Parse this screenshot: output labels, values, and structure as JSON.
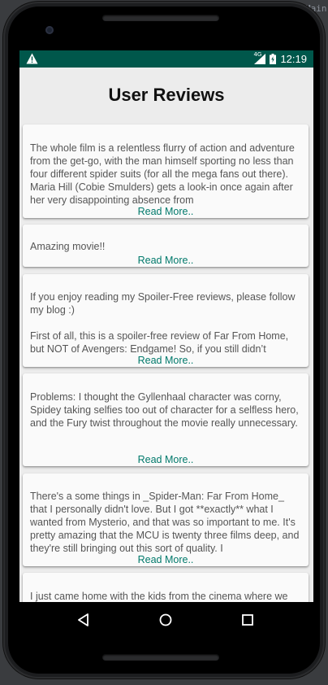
{
  "ide": {
    "right_fragment": "Main"
  },
  "status_bar": {
    "network_label": "4G",
    "time": "12:19"
  },
  "header": {
    "title": "User Reviews"
  },
  "reviews": [
    {
      "text": "The whole film is a relentless flurry of action and adventure from the get-go, with the man himself sporting no less than four different spider suits (for all the mega fans out there). Maria Hill (Cobie Smulders) gets a look-in once again after her very disappointing absence from",
      "link": "Read More.."
    },
    {
      "text": "Amazing movie!!",
      "link": "Read More.."
    },
    {
      "text": "If you enjoy reading my Spoiler-Free reviews, please follow my blog :)\n\nFirst of all, this is a spoiler-free review of Far From Home, but NOT of Avengers: Endgame! So, if you still didn’t",
      "link": "Read More.."
    },
    {
      "text": "Problems: I thought the Gyllenhaal character was corny, Spidey taking selfies too out of character for a selfless hero, and the Fury twist throughout the movie really unnecessary.",
      "link": "Read More.."
    },
    {
      "text": "There's a some things in _Spider-Man: Far From Home_ that I personally didn't love. But I got **exactly** what I wanted from Mysterio, and that was so important to me. It's pretty amazing that the MCU is twenty three films deep, and they're still bringing out this sort of quality. I",
      "link": "Read More.."
    },
    {
      "text": "I just came home with the kids from the cinema where we",
      "link": ""
    }
  ],
  "nav": {
    "back": "back-icon",
    "home": "home-icon",
    "recents": "recents-icon"
  },
  "colors": {
    "status_bar": "#00574b",
    "link": "#00796b",
    "background": "#ececec",
    "card": "#fafafa"
  }
}
